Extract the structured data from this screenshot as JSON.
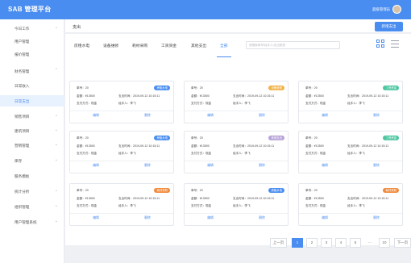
{
  "app": {
    "title": "SAB 管理平台"
  },
  "topbar": {
    "user_name": "超级管理员"
  },
  "sidebar": {
    "items": [
      {
        "label": "今日工作",
        "chevron": "⌄"
      },
      {
        "label": "用户管理",
        "chevron": ""
      },
      {
        "label": "报价管理",
        "chevron": ""
      },
      {
        "label": "财务管理",
        "chevron": "⌃"
      },
      {
        "label": "日常收入",
        "chevron": ""
      },
      {
        "label": "日常支出",
        "chevron": ""
      },
      {
        "label": "销售项目",
        "chevron": "⌄"
      },
      {
        "label": "建筑项目",
        "chevron": "⌄"
      },
      {
        "label": "营销管理",
        "chevron": "⌄"
      },
      {
        "label": "库存",
        "chevron": "⌄"
      },
      {
        "label": "服务模板",
        "chevron": ""
      },
      {
        "label": "统计分析",
        "chevron": "⌄"
      },
      {
        "label": "组织管理",
        "chevron": "⌄"
      },
      {
        "label": "用户管理系统",
        "chevron": "⌄"
      }
    ]
  },
  "header": {
    "title": "支出",
    "new_button": "新增支出"
  },
  "tabs": [
    {
      "label": "房租水电"
    },
    {
      "label": "设备维修"
    },
    {
      "label": "耗材采购"
    },
    {
      "label": "工资资金"
    },
    {
      "label": "其他支出"
    },
    {
      "label": "全部"
    }
  ],
  "search": {
    "placeholder": "请搜索单号/经手人/支出类型"
  },
  "view_icons": {
    "grid": "grid-view-icon",
    "list": "list-view-icon"
  },
  "card_labels": {
    "no_prefix": "单号：",
    "amount_prefix": "金额：",
    "time_prefix": "支出时间：",
    "method_prefix": "支付方式：",
    "handler_prefix": "经手人：",
    "edit": "编辑",
    "delete": "删除"
  },
  "cards": [
    {
      "no": "20",
      "amount": "¥13500",
      "time_label": "支出时间：",
      "time": "2019-09-12 10:15:11",
      "method": "现金",
      "handler": "李飞",
      "badge": "房租水电",
      "badge_color": "#4a8df0"
    },
    {
      "no": "20",
      "amount": "¥13500",
      "time_label": "支出时间：",
      "time": "2019-09-12 10:15:11",
      "method": "现金",
      "handler": "李飞",
      "badge": "设备维修",
      "badge_color": "#f2b24a"
    },
    {
      "no": "20",
      "amount": "¥13500",
      "time_label": "支出时间：",
      "time": "2019-09-12 10:15:11",
      "method": "现金",
      "handler": "李飞",
      "badge": "工资资金",
      "badge_color": "#4cc6a0"
    },
    {
      "no": "20",
      "amount": "¥13500",
      "time_label": "支出时间：",
      "time": "2019-09-12 10:15:11",
      "method": "现金",
      "handler": "李飞",
      "badge": "房租水电",
      "badge_color": "#4a8df0"
    },
    {
      "no": "20",
      "amount": "¥13500",
      "time_label": "支出时间：",
      "time": "2019-09-12 10:15:11",
      "method": "现金",
      "handler": "李飞",
      "badge": "其他支出",
      "badge_color": "#b7a3d8"
    },
    {
      "no": "20",
      "amount": "¥13500",
      "time_label": "支出时间：",
      "time": "2019-09-12 10:15:11",
      "method": "现金",
      "handler": "李飞",
      "badge": "工资资金",
      "badge_color": "#4cc6a0"
    },
    {
      "no": "20",
      "amount": "¥13500",
      "time_label": "支出时间：",
      "time": "2019-09-12 10:15:11",
      "method": "现金",
      "handler": "李飞",
      "badge": "耗材采购",
      "badge_color": "#f08a3c"
    },
    {
      "no": "20",
      "amount": "¥13500",
      "time_label": "支出时间：",
      "time": "2019-09-12 10:15:11",
      "method": "现金",
      "handler": "李飞",
      "badge": "房租水电",
      "badge_color": "#4a8df0"
    },
    {
      "no": "20",
      "amount": "¥13500",
      "time_label": "支出时间：",
      "time": "2019-09-12 10:15:11",
      "method": "现金",
      "handler": "李飞",
      "badge": "耗材采购",
      "badge_color": "#f08a3c"
    }
  ],
  "pagination": {
    "prev": "上一页",
    "pages": [
      "1",
      "2",
      "3",
      "4",
      "5",
      "...",
      "10"
    ],
    "current": "1",
    "next": "下一页"
  },
  "colors": {
    "accent": "#4a8df0",
    "topbar": "#4a8df0"
  }
}
